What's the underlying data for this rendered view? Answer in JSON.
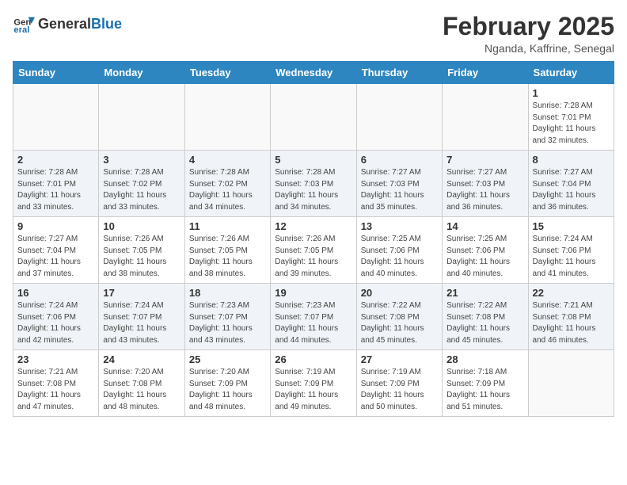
{
  "header": {
    "logo_general": "General",
    "logo_blue": "Blue",
    "month_title": "February 2025",
    "location": "Nganda, Kaffrine, Senegal"
  },
  "calendar": {
    "weekdays": [
      "Sunday",
      "Monday",
      "Tuesday",
      "Wednesday",
      "Thursday",
      "Friday",
      "Saturday"
    ],
    "weeks": [
      [
        {
          "day": "",
          "info": ""
        },
        {
          "day": "",
          "info": ""
        },
        {
          "day": "",
          "info": ""
        },
        {
          "day": "",
          "info": ""
        },
        {
          "day": "",
          "info": ""
        },
        {
          "day": "",
          "info": ""
        },
        {
          "day": "1",
          "info": "Sunrise: 7:28 AM\nSunset: 7:01 PM\nDaylight: 11 hours\nand 32 minutes."
        }
      ],
      [
        {
          "day": "2",
          "info": "Sunrise: 7:28 AM\nSunset: 7:01 PM\nDaylight: 11 hours\nand 33 minutes."
        },
        {
          "day": "3",
          "info": "Sunrise: 7:28 AM\nSunset: 7:02 PM\nDaylight: 11 hours\nand 33 minutes."
        },
        {
          "day": "4",
          "info": "Sunrise: 7:28 AM\nSunset: 7:02 PM\nDaylight: 11 hours\nand 34 minutes."
        },
        {
          "day": "5",
          "info": "Sunrise: 7:28 AM\nSunset: 7:03 PM\nDaylight: 11 hours\nand 34 minutes."
        },
        {
          "day": "6",
          "info": "Sunrise: 7:27 AM\nSunset: 7:03 PM\nDaylight: 11 hours\nand 35 minutes."
        },
        {
          "day": "7",
          "info": "Sunrise: 7:27 AM\nSunset: 7:03 PM\nDaylight: 11 hours\nand 36 minutes."
        },
        {
          "day": "8",
          "info": "Sunrise: 7:27 AM\nSunset: 7:04 PM\nDaylight: 11 hours\nand 36 minutes."
        }
      ],
      [
        {
          "day": "9",
          "info": "Sunrise: 7:27 AM\nSunset: 7:04 PM\nDaylight: 11 hours\nand 37 minutes."
        },
        {
          "day": "10",
          "info": "Sunrise: 7:26 AM\nSunset: 7:05 PM\nDaylight: 11 hours\nand 38 minutes."
        },
        {
          "day": "11",
          "info": "Sunrise: 7:26 AM\nSunset: 7:05 PM\nDaylight: 11 hours\nand 38 minutes."
        },
        {
          "day": "12",
          "info": "Sunrise: 7:26 AM\nSunset: 7:05 PM\nDaylight: 11 hours\nand 39 minutes."
        },
        {
          "day": "13",
          "info": "Sunrise: 7:25 AM\nSunset: 7:06 PM\nDaylight: 11 hours\nand 40 minutes."
        },
        {
          "day": "14",
          "info": "Sunrise: 7:25 AM\nSunset: 7:06 PM\nDaylight: 11 hours\nand 40 minutes."
        },
        {
          "day": "15",
          "info": "Sunrise: 7:24 AM\nSunset: 7:06 PM\nDaylight: 11 hours\nand 41 minutes."
        }
      ],
      [
        {
          "day": "16",
          "info": "Sunrise: 7:24 AM\nSunset: 7:06 PM\nDaylight: 11 hours\nand 42 minutes."
        },
        {
          "day": "17",
          "info": "Sunrise: 7:24 AM\nSunset: 7:07 PM\nDaylight: 11 hours\nand 43 minutes."
        },
        {
          "day": "18",
          "info": "Sunrise: 7:23 AM\nSunset: 7:07 PM\nDaylight: 11 hours\nand 43 minutes."
        },
        {
          "day": "19",
          "info": "Sunrise: 7:23 AM\nSunset: 7:07 PM\nDaylight: 11 hours\nand 44 minutes."
        },
        {
          "day": "20",
          "info": "Sunrise: 7:22 AM\nSunset: 7:08 PM\nDaylight: 11 hours\nand 45 minutes."
        },
        {
          "day": "21",
          "info": "Sunrise: 7:22 AM\nSunset: 7:08 PM\nDaylight: 11 hours\nand 45 minutes."
        },
        {
          "day": "22",
          "info": "Sunrise: 7:21 AM\nSunset: 7:08 PM\nDaylight: 11 hours\nand 46 minutes."
        }
      ],
      [
        {
          "day": "23",
          "info": "Sunrise: 7:21 AM\nSunset: 7:08 PM\nDaylight: 11 hours\nand 47 minutes."
        },
        {
          "day": "24",
          "info": "Sunrise: 7:20 AM\nSunset: 7:08 PM\nDaylight: 11 hours\nand 48 minutes."
        },
        {
          "day": "25",
          "info": "Sunrise: 7:20 AM\nSunset: 7:09 PM\nDaylight: 11 hours\nand 48 minutes."
        },
        {
          "day": "26",
          "info": "Sunrise: 7:19 AM\nSunset: 7:09 PM\nDaylight: 11 hours\nand 49 minutes."
        },
        {
          "day": "27",
          "info": "Sunrise: 7:19 AM\nSunset: 7:09 PM\nDaylight: 11 hours\nand 50 minutes."
        },
        {
          "day": "28",
          "info": "Sunrise: 7:18 AM\nSunset: 7:09 PM\nDaylight: 11 hours\nand 51 minutes."
        },
        {
          "day": "",
          "info": ""
        }
      ]
    ]
  }
}
